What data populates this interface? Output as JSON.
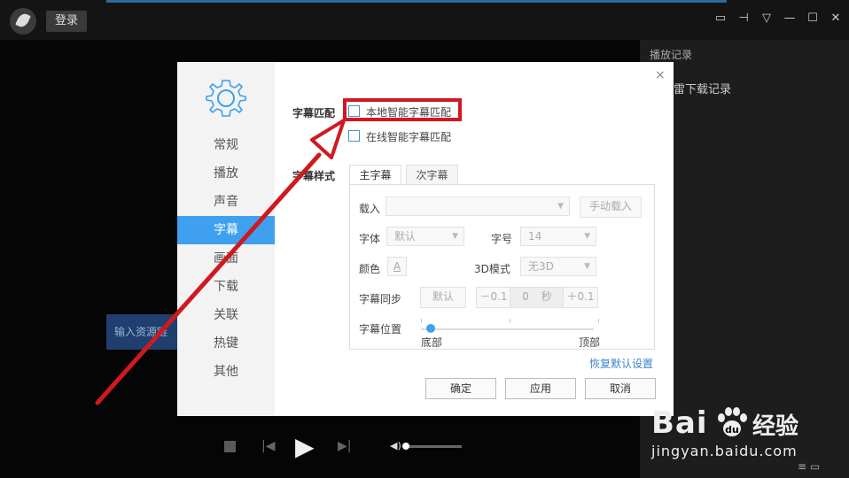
{
  "topbar": {
    "login_label": "登录",
    "icons": [
      "folder-icon",
      "pin-icon",
      "menu-icon",
      "minimize-icon",
      "maximize-icon",
      "close-icon"
    ],
    "glyphs": [
      "▭",
      "⊣",
      "▽",
      "—",
      "☐",
      "✕"
    ]
  },
  "sidepanel": {
    "title": "播放记录",
    "item": "雷下载记录",
    "bottom_icons": "≡ ▭"
  },
  "player": {
    "resource_button": "输入资源链",
    "controls": {
      "prev": "▶|",
      "play": "▶",
      "next": "▶|",
      "volume": "◀)"
    }
  },
  "dialog": {
    "close": "×",
    "nav": [
      "常规",
      "播放",
      "声音",
      "字幕",
      "画面",
      "下载",
      "关联",
      "热键",
      "其他"
    ],
    "active_nav": "字幕",
    "subtitle_match": {
      "label": "字幕匹配",
      "local": "本地智能字幕匹配",
      "online": "在线智能字幕匹配"
    },
    "subtitle_style": {
      "label": "字幕样式",
      "tabs": [
        "主字幕",
        "次字幕"
      ],
      "load_label": "载入",
      "load_value": "",
      "manual_load": "手动载入",
      "font_label": "字体",
      "font_value": "默认",
      "size_label": "字号",
      "size_value": "14",
      "color_label": "颜色",
      "color_glyph": "A",
      "mode3d_label": "3D模式",
      "mode3d_value": "无3D",
      "sync_label": "字幕同步",
      "sync_default": "默认",
      "sync_minus": "－0.1",
      "sync_value": "0",
      "sync_unit": "秒",
      "sync_plus": "＋0.1",
      "position_label": "字幕位置",
      "position_min": "底部",
      "position_max": "顶部",
      "position_level": 0
    },
    "restore_defaults": "恢复默认设置",
    "buttons": {
      "ok": "确定",
      "apply": "应用",
      "cancel": "取消"
    }
  },
  "watermark": {
    "logo": "Bai",
    "logo2": "du",
    "cn": "经验",
    "url": "jingyan.baidu.com"
  },
  "colors": {
    "accent": "#3ea0ee",
    "annotation": "#d0191f",
    "link": "#3a84c8"
  }
}
